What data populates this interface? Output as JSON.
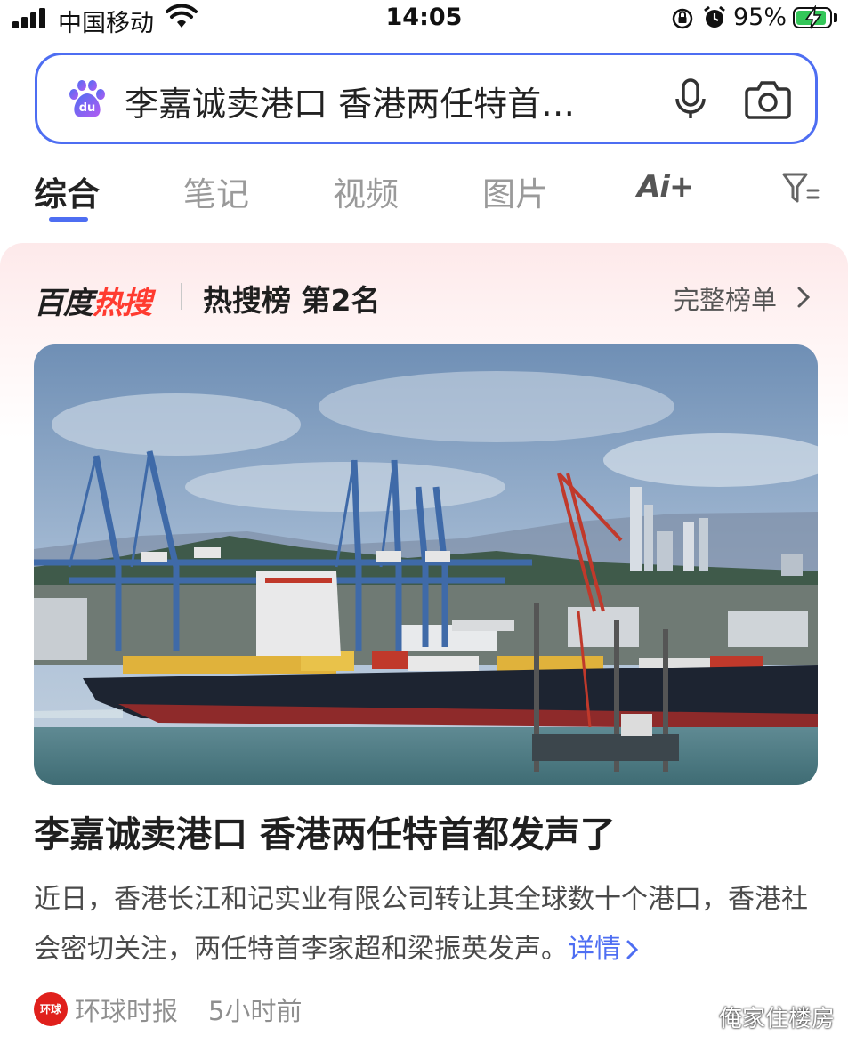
{
  "status_bar": {
    "carrier": "中国移动",
    "time": "14:05",
    "battery": "95%",
    "battery_level": 0.95
  },
  "search": {
    "query": "李嘉诚卖港口 香港两任特首…",
    "logo_icon": "baidu-paw-icon",
    "voice_icon": "microphone-icon",
    "camera_icon": "camera-icon"
  },
  "tabs": [
    {
      "label": "综合",
      "active": true
    },
    {
      "label": "笔记",
      "active": false
    },
    {
      "label": "视频",
      "active": false
    },
    {
      "label": "图片",
      "active": false
    },
    {
      "label": "Ai+",
      "active": false
    }
  ],
  "hot": {
    "brand_part1": "百度",
    "brand_part2": "热搜",
    "rank_label": "热搜榜  第2名",
    "full_list": "完整榜单",
    "accent": "#ff3b30"
  },
  "article": {
    "headline": "李嘉诚卖港口 香港两任特首都发声了",
    "summary": "近日，香港长江和记实业有限公司转让其全球数十个港口，香港社会密切关注，两任特首李家超和梁振英发声。",
    "detail_link": "详情",
    "source": "环球时报",
    "time": "5小时前"
  },
  "watermark": "俺家住楼房",
  "colors": {
    "brand_blue": "#4e6ef2",
    "hot_red": "#ff3b30"
  }
}
